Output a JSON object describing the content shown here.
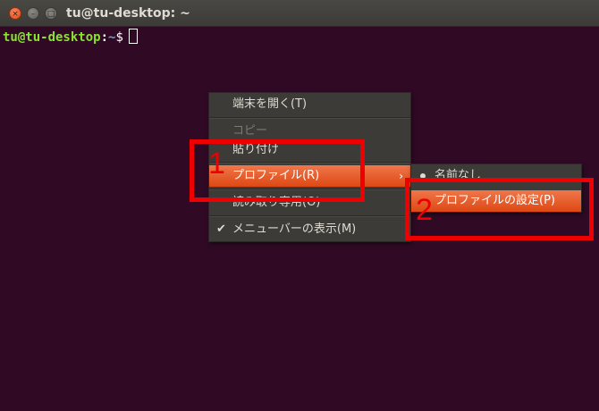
{
  "window": {
    "title": "tu@tu-desktop: ~",
    "controls": {
      "close": "×",
      "minimize": "–",
      "maximize": "□"
    }
  },
  "terminal": {
    "user_host": "tu@tu-desktop",
    "separator": ":",
    "path": "~",
    "symbol": "$"
  },
  "context_menu": {
    "items": [
      {
        "label": "端末を開く(T)",
        "enabled": true
      },
      {
        "label": "コピー",
        "enabled": false
      },
      {
        "label": "貼り付け",
        "enabled": true
      },
      {
        "label": "プロファイル(R)",
        "enabled": true,
        "highlighted": true,
        "submenu_arrow": "›"
      },
      {
        "label": "読み取り専用(O)",
        "enabled": true
      },
      {
        "label": "メニューバーの表示(M)",
        "enabled": true,
        "checked": true,
        "check_glyph": "✔"
      }
    ]
  },
  "submenu": {
    "items": [
      {
        "label": "名前なし",
        "selected": true
      },
      {
        "label": "プロファイルの設定(P)",
        "highlighted": true
      }
    ]
  },
  "annotations": {
    "step1": "1",
    "step2": "2",
    "color": "#ee0000"
  },
  "colors": {
    "terminal_bg": "#300a24",
    "accent": "#dd4814",
    "prompt_user": "#8ae234",
    "prompt_path": "#729fcf"
  }
}
